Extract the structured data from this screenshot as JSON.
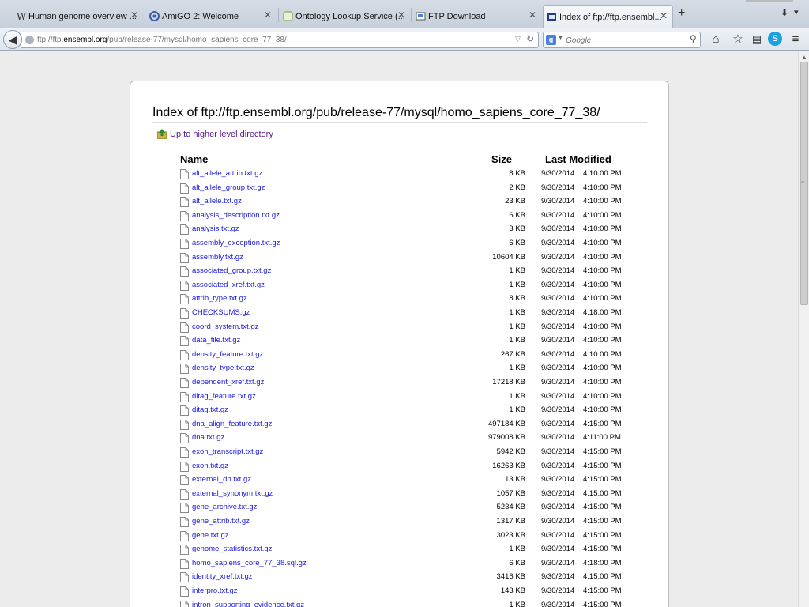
{
  "tabs": [
    {
      "label": "Human genome overview ...",
      "icon": "wiki-icon"
    },
    {
      "label": "AmiGO 2: Welcome",
      "icon": "amigo-icon"
    },
    {
      "label": "Ontology Lookup Service (...",
      "icon": "ols-icon"
    },
    {
      "label": "FTP Download",
      "icon": "ftp-icon"
    },
    {
      "label": "Index of ftp://ftp.ensembl...",
      "icon": "folder-icon",
      "active": true
    }
  ],
  "address": {
    "prefix": "ftp://ftp.",
    "domain": "ensembl.org",
    "path": "/pub/release-77/mysql/homo_sapiens_core_77_38/"
  },
  "search": {
    "placeholder": "Google"
  },
  "page": {
    "heading": "Index of ftp://ftp.ensembl.org/pub/release-77/mysql/homo_sapiens_core_77_38/",
    "up_link": "Up to higher level directory",
    "columns": {
      "name": "Name",
      "size": "Size",
      "modified": "Last Modified"
    }
  },
  "files": [
    {
      "name": "alt_allele_attrib.txt.gz",
      "size": "8 KB",
      "date": "9/30/2014",
      "time": "4:10:00 PM"
    },
    {
      "name": "alt_allele_group.txt.gz",
      "size": "2 KB",
      "date": "9/30/2014",
      "time": "4:10:00 PM"
    },
    {
      "name": "alt_allele.txt.gz",
      "size": "23 KB",
      "date": "9/30/2014",
      "time": "4:10:00 PM"
    },
    {
      "name": "analysis_description.txt.gz",
      "size": "6 KB",
      "date": "9/30/2014",
      "time": "4:10:00 PM"
    },
    {
      "name": "analysis.txt.gz",
      "size": "3 KB",
      "date": "9/30/2014",
      "time": "4:10:00 PM"
    },
    {
      "name": "assembly_exception.txt.gz",
      "size": "6 KB",
      "date": "9/30/2014",
      "time": "4:10:00 PM"
    },
    {
      "name": "assembly.txt.gz",
      "size": "10604 KB",
      "date": "9/30/2014",
      "time": "4:10:00 PM"
    },
    {
      "name": "associated_group.txt.gz",
      "size": "1 KB",
      "date": "9/30/2014",
      "time": "4:10:00 PM"
    },
    {
      "name": "associated_xref.txt.gz",
      "size": "1 KB",
      "date": "9/30/2014",
      "time": "4:10:00 PM"
    },
    {
      "name": "attrib_type.txt.gz",
      "size": "8 KB",
      "date": "9/30/2014",
      "time": "4:10:00 PM"
    },
    {
      "name": "CHECKSUMS.gz",
      "size": "1 KB",
      "date": "9/30/2014",
      "time": "4:18:00 PM"
    },
    {
      "name": "coord_system.txt.gz",
      "size": "1 KB",
      "date": "9/30/2014",
      "time": "4:10:00 PM"
    },
    {
      "name": "data_file.txt.gz",
      "size": "1 KB",
      "date": "9/30/2014",
      "time": "4:10:00 PM"
    },
    {
      "name": "density_feature.txt.gz",
      "size": "267 KB",
      "date": "9/30/2014",
      "time": "4:10:00 PM"
    },
    {
      "name": "density_type.txt.gz",
      "size": "1 KB",
      "date": "9/30/2014",
      "time": "4:10:00 PM"
    },
    {
      "name": "dependent_xref.txt.gz",
      "size": "17218 KB",
      "date": "9/30/2014",
      "time": "4:10:00 PM"
    },
    {
      "name": "ditag_feature.txt.gz",
      "size": "1 KB",
      "date": "9/30/2014",
      "time": "4:10:00 PM"
    },
    {
      "name": "ditag.txt.gz",
      "size": "1 KB",
      "date": "9/30/2014",
      "time": "4:10:00 PM"
    },
    {
      "name": "dna_align_feature.txt.gz",
      "size": "497184 KB",
      "date": "9/30/2014",
      "time": "4:15:00 PM"
    },
    {
      "name": "dna.txt.gz",
      "size": "979008 KB",
      "date": "9/30/2014",
      "time": "4:11:00 PM"
    },
    {
      "name": "exon_transcript.txt.gz",
      "size": "5942 KB",
      "date": "9/30/2014",
      "time": "4:15:00 PM"
    },
    {
      "name": "exon.txt.gz",
      "size": "16263 KB",
      "date": "9/30/2014",
      "time": "4:15:00 PM"
    },
    {
      "name": "external_db.txt.gz",
      "size": "13 KB",
      "date": "9/30/2014",
      "time": "4:15:00 PM"
    },
    {
      "name": "external_synonym.txt.gz",
      "size": "1057 KB",
      "date": "9/30/2014",
      "time": "4:15:00 PM"
    },
    {
      "name": "gene_archive.txt.gz",
      "size": "5234 KB",
      "date": "9/30/2014",
      "time": "4:15:00 PM"
    },
    {
      "name": "gene_attrib.txt.gz",
      "size": "1317 KB",
      "date": "9/30/2014",
      "time": "4:15:00 PM"
    },
    {
      "name": "gene.txt.gz",
      "size": "3023 KB",
      "date": "9/30/2014",
      "time": "4:15:00 PM"
    },
    {
      "name": "genome_statistics.txt.gz",
      "size": "1 KB",
      "date": "9/30/2014",
      "time": "4:15:00 PM"
    },
    {
      "name": "homo_sapiens_core_77_38.sql.gz",
      "size": "6 KB",
      "date": "9/30/2014",
      "time": "4:18:00 PM"
    },
    {
      "name": "identity_xref.txt.gz",
      "size": "3416 KB",
      "date": "9/30/2014",
      "time": "4:15:00 PM"
    },
    {
      "name": "interpro.txt.gz",
      "size": "143 KB",
      "date": "9/30/2014",
      "time": "4:15:00 PM"
    },
    {
      "name": "intron_supporting_evidence.txt.gz",
      "size": "1 KB",
      "date": "9/30/2014",
      "time": "4:15:00 PM"
    }
  ],
  "colors": {
    "link": "#1a1ae0",
    "visited": "#551a8b"
  }
}
